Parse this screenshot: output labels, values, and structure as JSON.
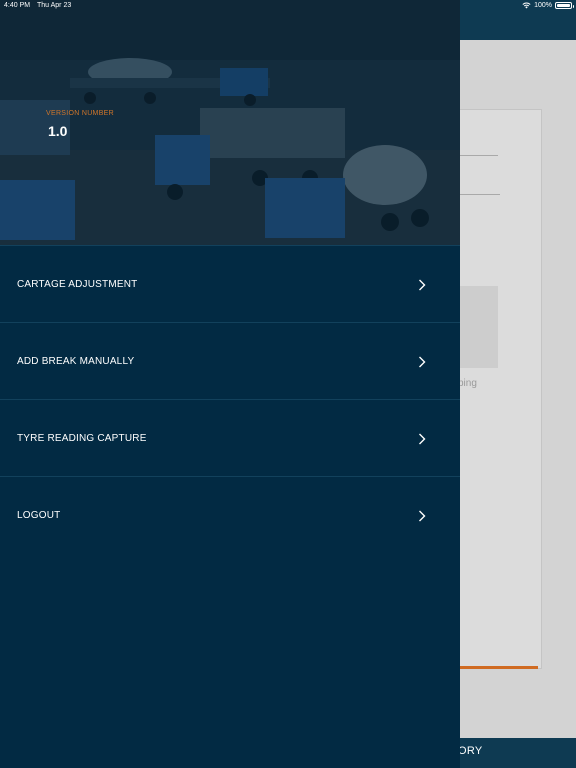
{
  "status_bar": {
    "time": "4:40 PM",
    "date": "Thu Apr 23",
    "battery": "100%"
  },
  "drawer": {
    "version_label": "VERSION NUMBER",
    "version_value": "1.0",
    "menu_items": [
      {
        "label": "CARTAGE ADJUSTMENT"
      },
      {
        "label": "ADD BREAK MANUALLY"
      },
      {
        "label": "TYRE READING CAPTURE"
      },
      {
        "label": "LOGOUT"
      }
    ]
  },
  "background_app": {
    "faint_text": "ping",
    "tab_label": "ORY"
  },
  "colors": {
    "drawer_bg": "#022a43",
    "header_bg": "#0e3a52",
    "accent": "#d06b22",
    "version_label": "#d0762a"
  }
}
